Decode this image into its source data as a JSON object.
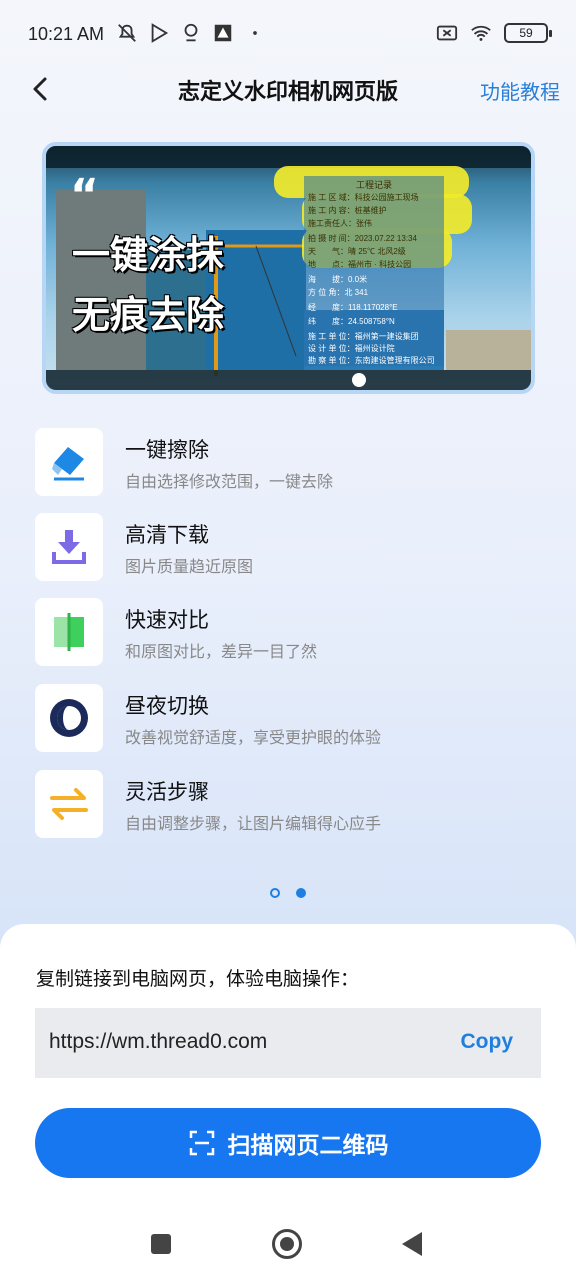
{
  "status_bar": {
    "time": "10:21 AM",
    "battery": "59",
    "icons": [
      "mute-icon",
      "play-icon",
      "location-icon",
      "app-icon",
      "dot-icon",
      "sim-off-icon",
      "wifi-icon",
      "battery-icon"
    ]
  },
  "header": {
    "title": "志定义水印相机网页版",
    "tutorial": "功能教程"
  },
  "banner": {
    "quote": "“",
    "line1": "一键涂抹",
    "line2": "无痕去除",
    "watermark": {
      "title": "工程记录",
      "rows": [
        "施 工 区 域：科技公园施工现场",
        "施 工 内 容：桩基维护",
        "施工责任人：张伟",
        "拍 摄 时 间：2023.07.22 13:34",
        "天　　气：晴 25℃ 北风2级",
        "地　　点：福州市 · 科技公园",
        "海　　拔：0.0米",
        "方 位 角：北 341",
        "经　　度：118.117028°E",
        "纬　　度：24.508758°N",
        "施 工 单 位：福州第一建设集团",
        "设 计 单 位：福州设计院",
        "勘 察 单 位：东南建设管理有限公司"
      ]
    }
  },
  "features": [
    {
      "title": "一键擦除",
      "desc": "自由选择修改范围，一键去除",
      "icon": "eraser-icon"
    },
    {
      "title": "高清下载",
      "desc": "图片质量趋近原图",
      "icon": "download-icon"
    },
    {
      "title": "快速对比",
      "desc": "和原图对比，差异一目了然",
      "icon": "compare-icon"
    },
    {
      "title": "昼夜切换",
      "desc": "改善视觉舒适度，享受更护眼的体验",
      "icon": "day-night-icon"
    },
    {
      "title": "灵活步骤",
      "desc": "自由调整步骤，让图片编辑得心应手",
      "icon": "swap-arrows-icon"
    }
  ],
  "pager": {
    "count": 2,
    "active": 1
  },
  "sheet": {
    "prompt": "复制链接到电脑网页，体验电脑操作：",
    "url": "https://wm.thread0.com",
    "copy": "Copy",
    "scan": "扫描网页二维码"
  },
  "colors": {
    "accent": "#1677f0",
    "link": "#2a7fd8",
    "highlight": "#f2ea2a"
  }
}
